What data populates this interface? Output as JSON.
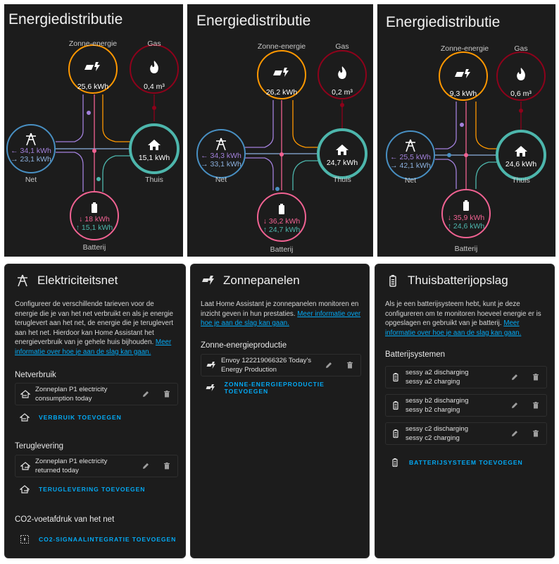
{
  "colors": {
    "solar": "#ff9800",
    "gas": "#8e021b",
    "grid": "#488fc2",
    "home": "#4db6ac",
    "battery": "#f06292",
    "battery_in": "#f06292",
    "battery_out": "#4db6ac",
    "grid_in": "#a280db",
    "grid_out": "#8cb1de",
    "link": "#03a9f4"
  },
  "flows": [
    {
      "title": "Energiedistributie",
      "solar": {
        "label": "Zonne-energie",
        "value": "25,6 kWh"
      },
      "gas": {
        "label": "Gas",
        "value": "0,4 m³"
      },
      "grid": {
        "label": "Net",
        "in": "← 34,1 kWh",
        "out": "→ 23,1 kWh"
      },
      "home": {
        "label": "Thuis",
        "value": "15,1 kWh"
      },
      "battery": {
        "label": "Batterij",
        "in": "↓ 18 kWh",
        "out": "↑ 15,1 kWh"
      }
    },
    {
      "title": "Energiedistributie",
      "solar": {
        "label": "Zonne-energie",
        "value": "26,2 kWh"
      },
      "gas": {
        "label": "Gas",
        "value": "0,2 m³"
      },
      "grid": {
        "label": "Net",
        "in": "← 34,3 kWh",
        "out": "→ 33,1 kWh"
      },
      "home": {
        "label": "Thuis",
        "value": "24,7 kWh"
      },
      "battery": {
        "label": "Batterij",
        "in": "↓ 36,2 kWh",
        "out": "↑ 24,7 kWh"
      }
    },
    {
      "title": "Energiedistributie",
      "solar": {
        "label": "Zonne-energie",
        "value": "9,3 kWh"
      },
      "gas": {
        "label": "Gas",
        "value": "0,6 m³"
      },
      "grid": {
        "label": "Net",
        "in": "← 25,5 kWh",
        "out": "→ 42,1 kWh"
      },
      "home": {
        "label": "Thuis",
        "value": "24,6 kWh"
      },
      "battery": {
        "label": "Batterij",
        "in": "↓ 35,9 kWh",
        "out": "↑ 24,6 kWh"
      }
    }
  ],
  "grid_card": {
    "title": "Elektriciteitsnet",
    "desc": "Configureer de verschillende tarieven voor de energie die je van het net verbruikt en als je energie teruglevert aan het net, de energie die je teruglevert aan het net. Hierdoor kan Home Assistant het energieverbruik van je gehele huis bijhouden.",
    "link": "Meer informatie over hoe je aan de slag kan gaan.",
    "consumption_title": "Netverbruik",
    "consumption_item_line1": "Zonneplan P1 electricity",
    "consumption_item_line2": "consumption today",
    "consumption_add": "VERBRUIK TOEVOEGEN",
    "return_title": "Teruglevering",
    "return_item_line1": "Zonneplan P1 electricity",
    "return_item_line2": "returned today",
    "return_add": "TERUGLEVERING TOEVOEGEN",
    "co2_title": "CO2-voetafdruk van het net",
    "co2_add": "CO2-SIGNAALINTEGRATIE TOEVOEGEN"
  },
  "solar_card": {
    "title": "Zonnepanelen",
    "desc": "Laat Home Assistant je zonnepanelen monitoren en inzicht geven in hun prestaties.",
    "link": "Meer informatie over hoe je aan de slag kan gaan.",
    "section_title": "Zonne-energieproductie",
    "item_line1": "Envoy 122219066326 Today's",
    "item_line2": "Energy Production",
    "add": "ZONNE-ENERGIEPRODUCTIE TOEVOEGEN"
  },
  "battery_card": {
    "title": "Thuisbatterijopslag",
    "desc": "Als je een batterijsysteem hebt, kunt je deze configureren om te monitoren hoeveel energie er is opgeslagen en gebruikt van je batterij.",
    "link": "Meer informatie over hoe je aan de slag kan gaan.",
    "section_title": "Batterijsystemen",
    "items": [
      {
        "line1": "sessy a2 discharging",
        "line2": "sessy a2 charging"
      },
      {
        "line1": "sessy b2 discharging",
        "line2": "sessy b2 charging"
      },
      {
        "line1": "sessy c2 discharging",
        "line2": "sessy c2 charging"
      }
    ],
    "add": "BATTERIJSYSTEEM TOEVOEGEN"
  }
}
